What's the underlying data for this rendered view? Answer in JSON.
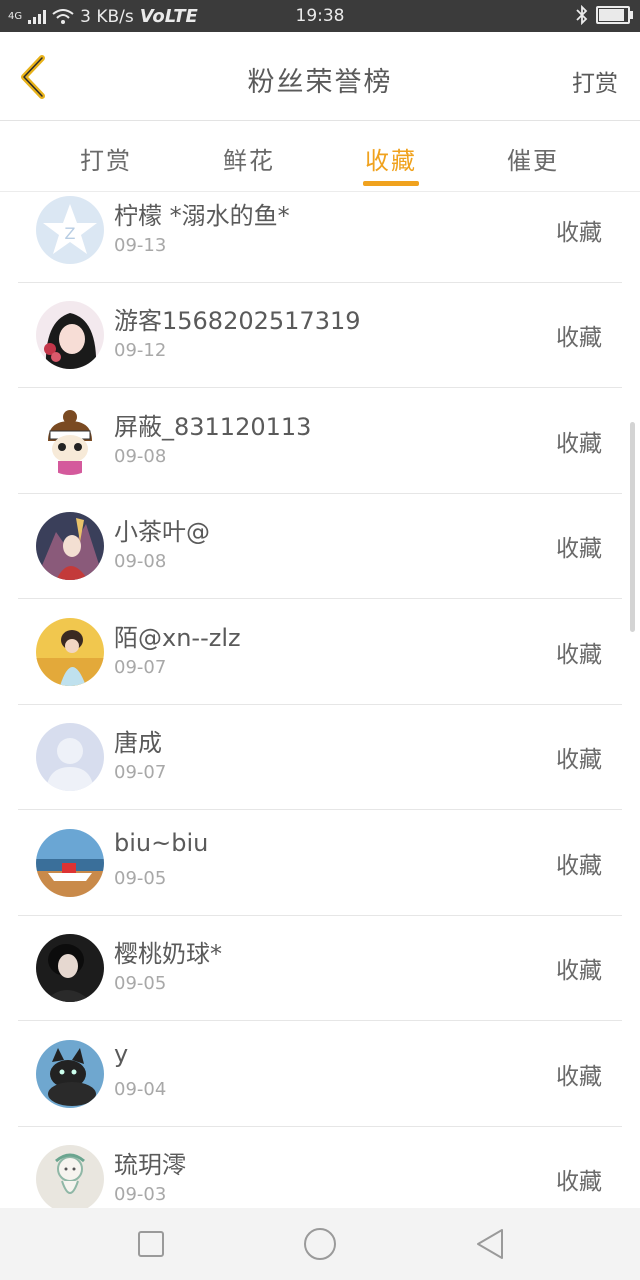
{
  "status_bar": {
    "network": "4G",
    "speed": "3 KB/s",
    "volte": "VoLTE",
    "time": "19:38",
    "bluetooth_icon": "bluetooth-icon",
    "battery_level": 0.95
  },
  "header": {
    "title": "粉丝荣誉榜",
    "action_label": "打赏",
    "back_icon": "back-chevron-icon",
    "back_color": "#e8b21a"
  },
  "tabs": [
    {
      "label": "打赏",
      "active": false
    },
    {
      "label": "鲜花",
      "active": false
    },
    {
      "label": "收藏",
      "active": true
    },
    {
      "label": "催更",
      "active": false
    }
  ],
  "accent_color": "#f0a21e",
  "list": [
    {
      "name": "柠檬 *溺水的鱼*",
      "date": "09-13",
      "action": "收藏",
      "avatar": "default-star-avatar"
    },
    {
      "name": "游客1568202517319",
      "date": "09-12",
      "action": "收藏",
      "avatar": "anime-girl-avatar"
    },
    {
      "name": "屏蔽_831120113",
      "date": "09-08",
      "action": "收藏",
      "avatar": "cartoon-girl-avatar"
    },
    {
      "name": "小茶叶@",
      "date": "09-08",
      "action": "收藏",
      "avatar": "anime-character-avatar"
    },
    {
      "name": "陌@xn--zlz",
      "date": "09-07",
      "action": "收藏",
      "avatar": "field-girl-avatar"
    },
    {
      "name": "唐成",
      "date": "09-07",
      "action": "收藏",
      "avatar": "default-person-avatar"
    },
    {
      "name": "biu~biu",
      "date": "09-05",
      "action": "收藏",
      "avatar": "boat-beach-avatar"
    },
    {
      "name": "樱桃奶球*",
      "date": "09-05",
      "action": "收藏",
      "avatar": "dark-portrait-avatar"
    },
    {
      "name": "y",
      "date": "09-04",
      "action": "收藏",
      "avatar": "black-cat-avatar"
    },
    {
      "name": "琉玥澪",
      "date": "09-03",
      "action": "收藏",
      "avatar": "sketch-avatar"
    }
  ],
  "nav_bar": {
    "recent_icon": "square-icon",
    "home_icon": "circle-icon",
    "back_icon": "triangle-back-icon"
  }
}
